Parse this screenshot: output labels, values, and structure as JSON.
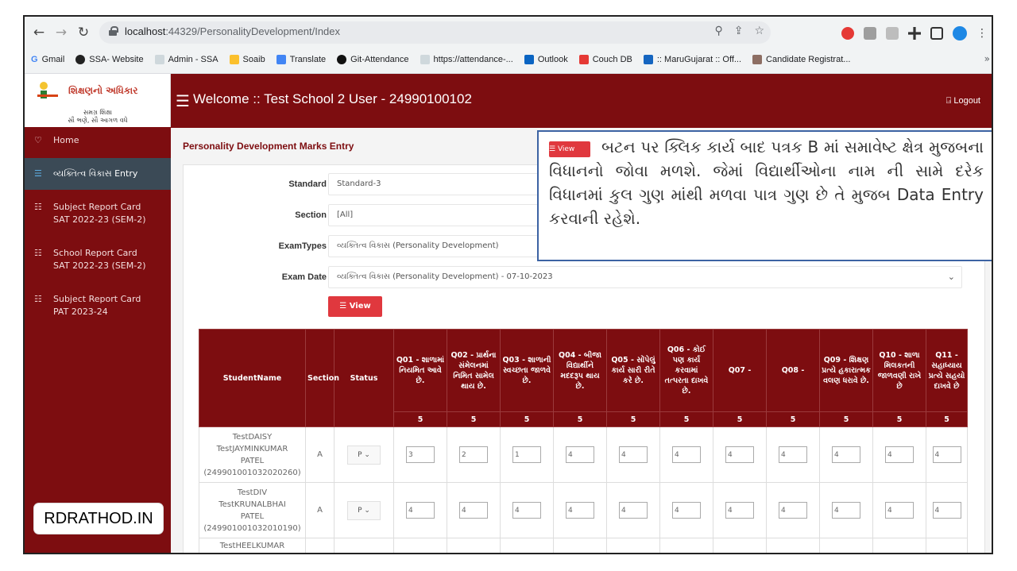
{
  "browser": {
    "url_host": "localhost",
    "url_path": ":44329/PersonalityDevelopment/Index",
    "bookmarks": [
      "Gmail",
      "SSA- Website",
      "Admin - SSA",
      "Soaib",
      "Translate",
      "Git-Attendance",
      "https://attendance-...",
      "Outlook",
      "Couch DB",
      ":: MaruGujarat :: Off...",
      "Candidate Registrat..."
    ],
    "more": "»"
  },
  "logo": {
    "title": "શિક્ષણનો અધિકાર",
    "line1": "સમગ્ર શિક્ષા",
    "line2": "સૌ ભણે, સૌ આગળ વધે"
  },
  "sidebar": {
    "items": [
      {
        "label": "Home",
        "sub": ""
      },
      {
        "label": "વ્યક્તિત્વ વિકાસ Entry",
        "sub": ""
      },
      {
        "label": "Subject Report Card",
        "sub": "SAT 2022-23 (SEM-2)"
      },
      {
        "label": "School Report Card",
        "sub": "SAT 2022-23 (SEM-2)"
      },
      {
        "label": "Subject Report Card",
        "sub": "PAT 2023-24"
      }
    ]
  },
  "topbar": {
    "welcome": "Welcome :: Test School 2 User - 24990100102",
    "logout": "Logout"
  },
  "page": {
    "title": "Personality Development Marks Entry",
    "standard_label": "Standard",
    "standard_value": "Standard-3",
    "section_label": "Section",
    "section_value": "[All]",
    "examtypes_label": "ExamTypes",
    "examtypes_value": "વ્યક્તિત્વ વિકાસ (Personality Development)",
    "examdate_label": "Exam Date",
    "examdate_value": "વ્યક્તિત્વ વિકાસ (Personality Development) - 07-10-2023",
    "view_label": "View"
  },
  "table": {
    "headers": {
      "student": "StudentName",
      "section": "Section",
      "status": "Status",
      "q01": "Q01 - શાળામાં નિયમિત આવે છે.",
      "q02": "Q02 - પ્રાર્થના સંમેલનમાં નિમિત સામેલ થાય છે.",
      "q03": "Q03 - શાળાની સ્વચ્છતા જાળવે છે.",
      "q04": "Q04 - બીજા વિદ્યાર્થીને મદદરૂપ થાય છે.",
      "q05": "Q05 - સોંપેલું કાર્ય સારી રીતે કરે છે.",
      "q06": "Q06 - કોઈ પણ કાર્ય કરવામાં તત્પરતા દાખવે છે.",
      "q07": "Q07 -",
      "q08": "Q08 -",
      "q09": "Q09 - શિક્ષણ પ્રત્યે હકારાત્મક વલણ ધરાવે છે.",
      "q10": "Q10 - શાળા મિલકતની જાળવણી રાખે છે",
      "q11": "Q11 - સહાધ્યાય પ્રત્યે સહયો દાખવે છે"
    },
    "max_marks": [
      "5",
      "5",
      "5",
      "5",
      "5",
      "5",
      "5",
      "5",
      "5",
      "5",
      "5"
    ],
    "rows": [
      {
        "name1": "TestDAISY",
        "name2": "TestJAYMINKUMAR",
        "name3": "PATEL",
        "name4": "(249901001032020260)",
        "section": "A",
        "status": "P",
        "marks": [
          "3",
          "2",
          "1",
          "4",
          "4",
          "4",
          "4",
          "4",
          "4",
          "4",
          "4"
        ]
      },
      {
        "name1": "TestDIV",
        "name2": "TestKRUNALBHAI",
        "name3": "PATEL",
        "name4": "(249901001032010190)",
        "section": "A",
        "status": "P",
        "marks": [
          "4",
          "4",
          "4",
          "4",
          "4",
          "4",
          "4",
          "4",
          "4",
          "4",
          "4"
        ]
      },
      {
        "name1": "TestHEELKUMAR",
        "name2": "",
        "name3": "",
        "name4": "",
        "section": "",
        "status": "",
        "marks": [
          "",
          "",
          "",
          "",
          "",
          "",
          "",
          "",
          "",
          "",
          ""
        ]
      }
    ]
  },
  "callout": {
    "button_label": "View",
    "text": "બટન પર ક્લિક કાર્ય બાદ પત્રક B માં સમાવેષ્ટ ક્ષેત્ર મુજબના વિધાનનો જોવા મળશે. જેમાં વિદ્યાર્થીઓના નામ ની સામે દરેક વિધાનમાં કુલ ગુણ માંથી મળવા પાત્ર ગુણ છે તે મુજબ Data Entry કરવાની રહેશે."
  },
  "brand": {
    "text": "RDRATHOD.IN"
  },
  "colors": {
    "maroon": "#7d0d10",
    "button_red": "#e0383e",
    "callout_border": "#3c63a3",
    "sidebar_active": "#3b4a56"
  }
}
